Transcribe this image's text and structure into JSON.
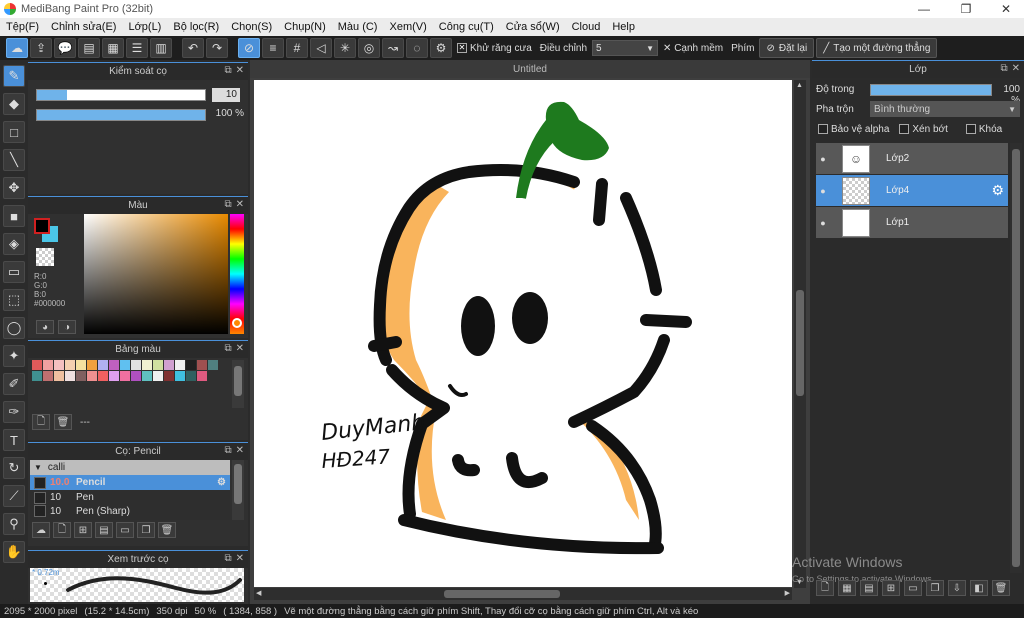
{
  "window": {
    "title": "MediBang Paint Pro (32bit)",
    "min": "—",
    "max": "❐",
    "close": "✕"
  },
  "menu": [
    "Tệp(F)",
    "Chỉnh sửa(E)",
    "Lớp(L)",
    "Bộ lọc(R)",
    "Chọn(S)",
    "Chụp(N)",
    "Màu (C)",
    "Xem(V)",
    "Công cụ(T)",
    "Cửa sổ(W)",
    "Cloud",
    "Help"
  ],
  "toolbar": {
    "antialias": "Khử răng cưa",
    "adjust_label": "Điều chỉnh",
    "adjust_value": "5",
    "smooth": "Cạnh mềm",
    "key_label": "Phím",
    "reset": "Đặt lại",
    "straight": "Tạo một đường thẳng"
  },
  "brush_control": {
    "title": "Kiểm soát cọ",
    "size_value": "10",
    "opacity_value": "100 %",
    "size_fraction": 0.18,
    "opacity_fraction": 1.0
  },
  "color_panel": {
    "title": "Màu",
    "r": "R:0",
    "g": "G:0",
    "b": "B:0",
    "hex": "#000000"
  },
  "palette": {
    "title": "Bảng màu",
    "name": "---",
    "colors": [
      "#e05a5a",
      "#f0a0a0",
      "#f5c0c0",
      "#f5d0b0",
      "#f5e0a0",
      "#f0a040",
      "#b0b0f0",
      "#c060c0",
      "#60c0f0",
      "#e0e0e0",
      "#f0f0d0",
      "#d0e0a0",
      "#d0a0d0",
      "#f0f0f0",
      "#202020",
      "#a05050",
      "#508080",
      "#409090",
      "#c07070",
      "#f0c0a0",
      "#f0e0e0",
      "#806060",
      "#f09090",
      "#f06060",
      "#e0a0f0",
      "#f070a0",
      "#b050c0",
      "#60c0c0",
      "#f0f0f0",
      "#803030",
      "#40c0e0",
      "#306060",
      "#e05a80"
    ]
  },
  "brushes": {
    "title": "Cọ: Pencil",
    "group": "calli",
    "items": [
      {
        "size": "10.0",
        "name": "Pencil"
      },
      {
        "size": "10",
        "name": "Pen"
      },
      {
        "size": "10",
        "name": "Pen (Sharp)"
      }
    ]
  },
  "preview": {
    "title": "Xem trước cọ",
    "size": "* 0.72m"
  },
  "document": {
    "tab": "Untitled"
  },
  "layers": {
    "title": "Lớp",
    "opacity_label": "Độ trong",
    "opacity_value": "100 %",
    "opacity_fraction": 1.0,
    "blend_label": "Pha trộn",
    "blend_value": "Bình thường",
    "protect_alpha": "Bảo vệ alpha",
    "clipping": "Xén bớt",
    "lock": "Khóa",
    "items": [
      {
        "name": "Lớp2"
      },
      {
        "name": "Lớp4"
      },
      {
        "name": "Lớp1"
      }
    ]
  },
  "watermark": {
    "line1": "Activate Windows",
    "line2": "Go to Settings to activate Windows."
  },
  "status": {
    "size": "2095 * 2000 pixel",
    "cm": "(15.2 * 14.5cm)",
    "dpi": "350 dpi",
    "zoom": "50 %",
    "coords": "( 1384, 858 )",
    "hint": "Vẽ một đường thẳng bằng cách giữ phím Shift, Thay đổi cỡ cọ bằng cách giữ phím Ctrl, Alt và kéo"
  },
  "drawing": {
    "signature1": "DuyManh",
    "signature2": "HĐ247"
  },
  "colors": {
    "accent": "#4a90d9",
    "fg": "#000000",
    "bg": "#4bc6e8",
    "sprout": "#1e7a1e",
    "skin": "#f9b45c"
  }
}
